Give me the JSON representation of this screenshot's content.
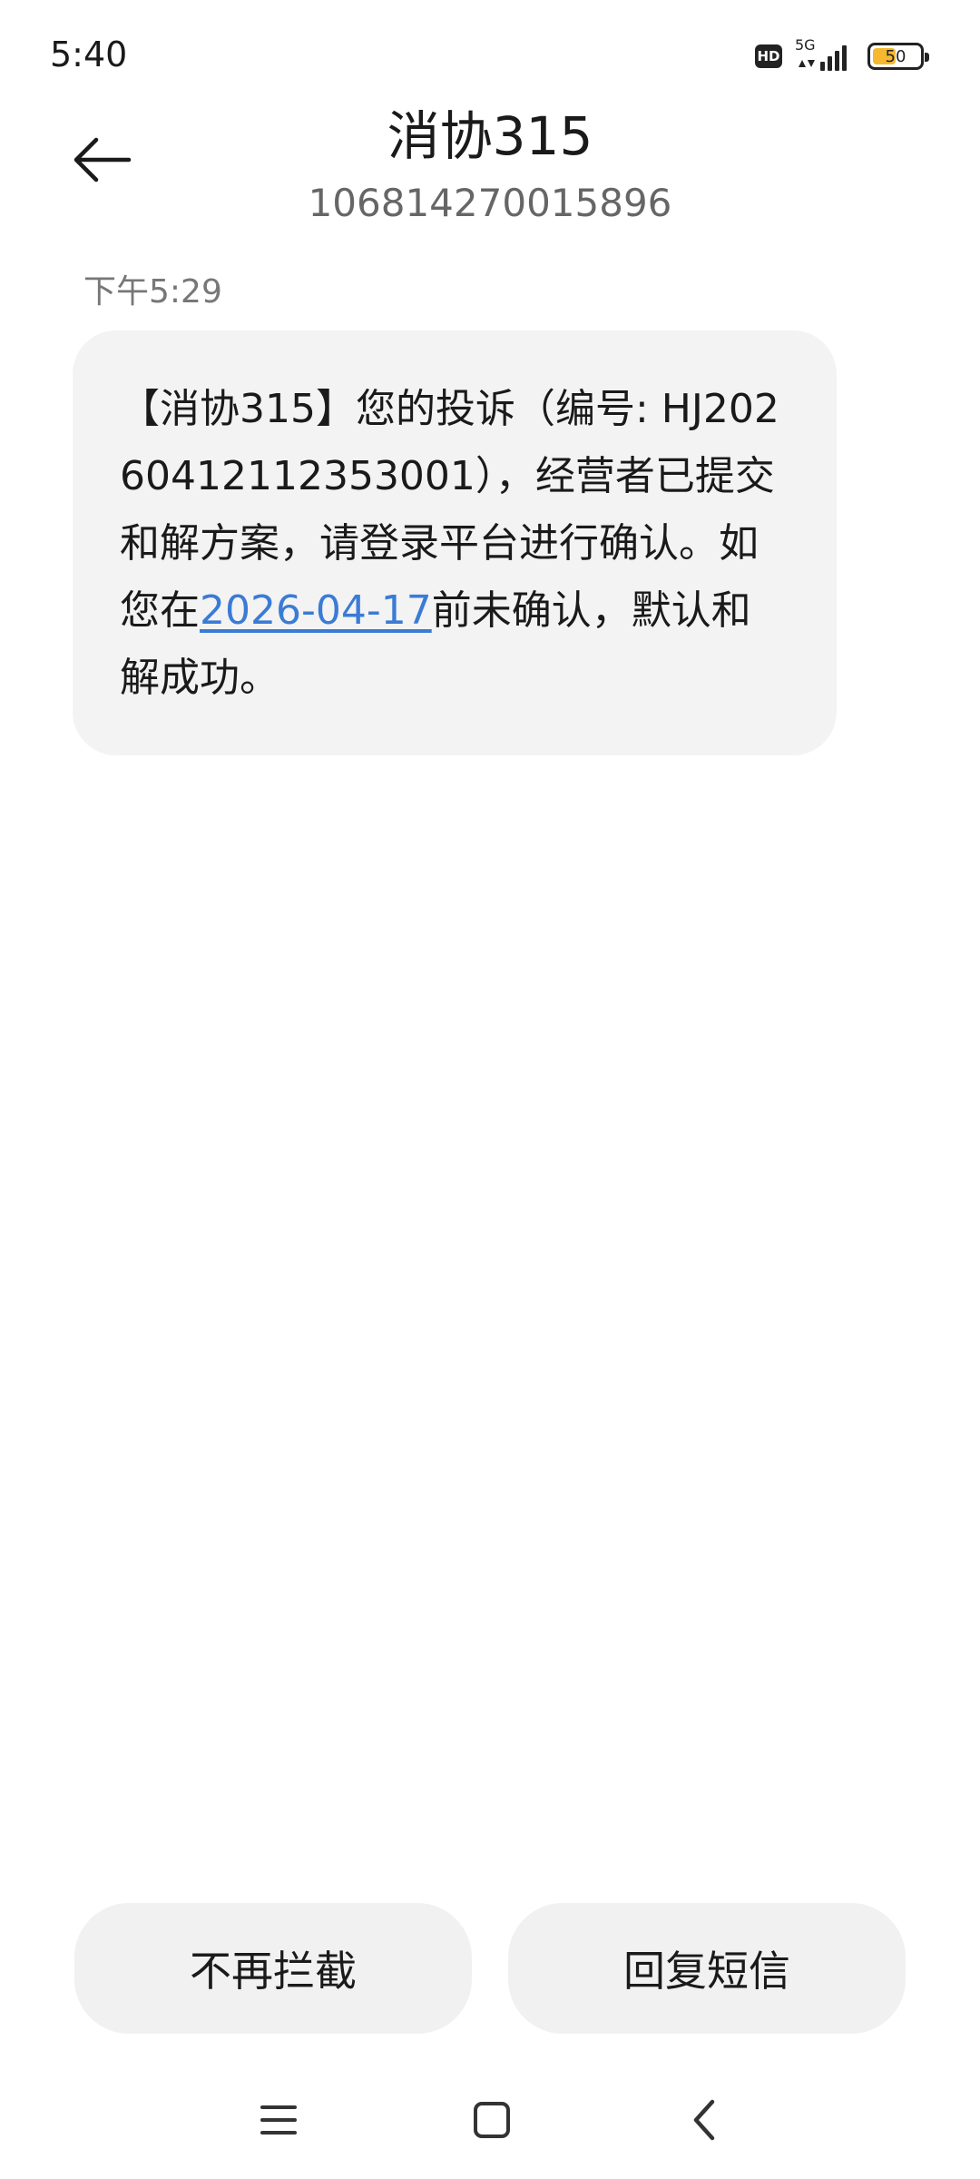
{
  "status_bar": {
    "time": "5:40",
    "hd_label": "HD",
    "network_label": "5G",
    "battery_level": "50",
    "battery_fraction": 0.5,
    "battery_color": "#f5b82e"
  },
  "header": {
    "contact_name": "消协315",
    "contact_number": "106814270015896"
  },
  "message": {
    "time": "下午5:29",
    "text_before_link": "【消协315】您的投诉（编号: HJ20260412112353001），经营者已提交和解方案，请登录平台进行确认。如您在",
    "link_text": "2026-04-17",
    "text_after_link": "前未确认，默认和解成功。",
    "link_color": "#3a7bd5"
  },
  "actions": {
    "block_label": "不再拦截",
    "reply_label": "回复短信"
  },
  "nav": {
    "menu_icon": "menu-icon",
    "home_icon": "home-icon",
    "back_icon": "back-icon"
  }
}
